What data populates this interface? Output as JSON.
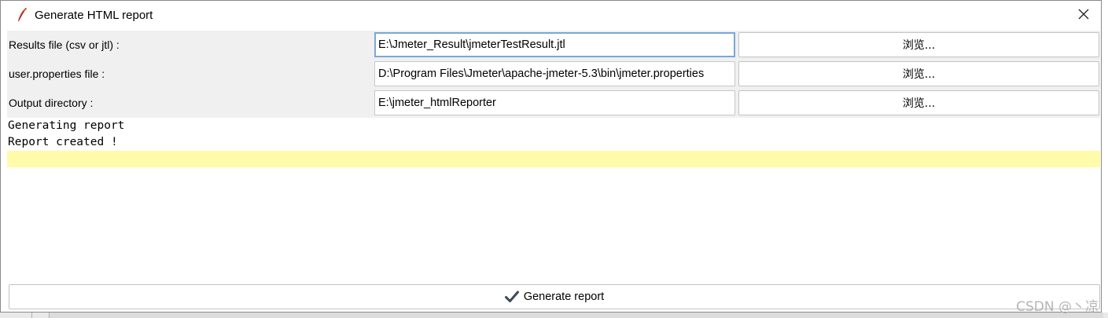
{
  "window": {
    "title": "Generate HTML report",
    "icon": "feather-icon",
    "close_icon": "close-icon"
  },
  "form": {
    "rows": [
      {
        "label": "Results file (csv or jtl) :",
        "value": "E:\\Jmeter_Result\\jmeterTestResult.jtl",
        "browse_label": "浏览..."
      },
      {
        "label": "user.properties file :",
        "value": "D:\\Program Files\\Jmeter\\apache-jmeter-5.3\\bin\\jmeter.properties",
        "browse_label": "浏览..."
      },
      {
        "label": "Output directory :",
        "value": "E:\\jmeter_htmlReporter",
        "browse_label": "浏览..."
      }
    ]
  },
  "log": {
    "lines": [
      "Generating report",
      "Report created !"
    ],
    "highlight_color": "#fffbaa"
  },
  "footer": {
    "generate_label": "Generate report",
    "generate_icon": "checkmark-icon"
  },
  "watermark": "CSDN @丶凉"
}
